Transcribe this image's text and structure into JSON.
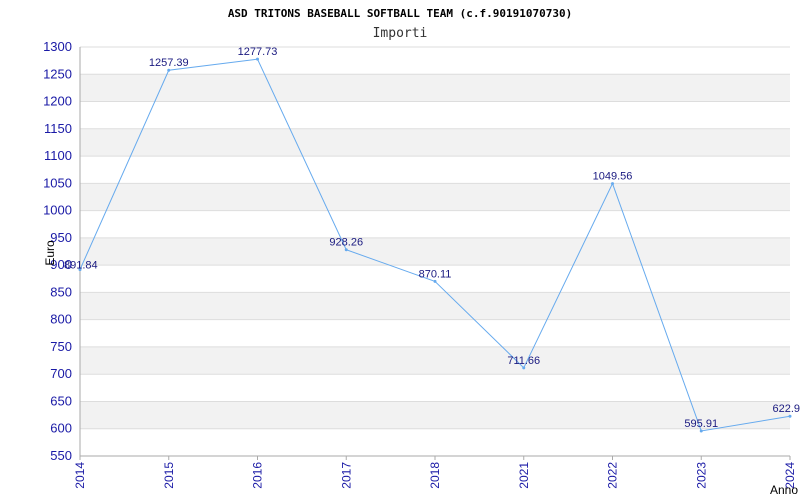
{
  "chart_data": {
    "type": "line",
    "title": "ASD TRITONS BASEBALL SOFTBALL TEAM (c.f.90191070730)",
    "subtitle": "Importi",
    "xlabel": "Anno",
    "ylabel": "Euro",
    "categories": [
      "2014",
      "2015",
      "2016",
      "2017",
      "2018",
      "2021",
      "2022",
      "2023",
      "2024"
    ],
    "values": [
      891.84,
      1257.39,
      1277.73,
      928.26,
      870.11,
      711.66,
      1049.56,
      595.91,
      622.9
    ],
    "value_labels": [
      "891.84",
      "1257.39",
      "1277.73",
      "928.26",
      "870.11",
      "711.66",
      "1049.56",
      "595.91",
      "622.9"
    ],
    "ylim": [
      550,
      1300
    ],
    "yticks": [
      "550",
      "600",
      "650",
      "700",
      "750",
      "800",
      "850",
      "900",
      "950",
      "1000",
      "1050",
      "1100",
      "1150",
      "1200",
      "1250",
      "1300"
    ],
    "grid": true,
    "colors": {
      "line": "#66aaee",
      "band": "#f2f2f2",
      "grid": "#dddddd",
      "axis": "#aaaaaa",
      "tick_text": "#1a1aa6"
    }
  }
}
